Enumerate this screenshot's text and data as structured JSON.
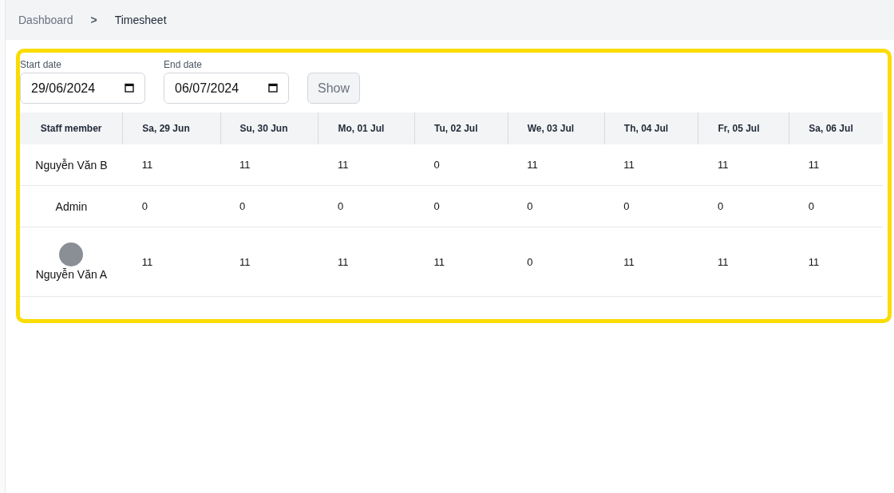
{
  "breadcrumb": [
    {
      "label": "Dashboard",
      "current": false
    },
    {
      "label": "Timesheet",
      "current": true
    }
  ],
  "breadcrumb_separator": ">",
  "filters": [
    {
      "label": "Start date",
      "value": "29/06/2024"
    },
    {
      "label": "End date",
      "value": "06/07/2024"
    }
  ],
  "show_button": "Show",
  "table": {
    "columns": [
      "Staff member",
      "Sa, 29 Jun",
      "Su, 30 Jun",
      "Mo, 01 Jul",
      "Tu, 02 Jul",
      "We, 03 Jul",
      "Th, 04 Jul",
      "Fr, 05 Jul",
      "Sa, 06 Jul"
    ],
    "rows": [
      {
        "name": "Nguyễn Văn B",
        "avatar": false,
        "hours": [
          "11",
          "11",
          "11",
          "0",
          "11",
          "11",
          "11",
          "11"
        ]
      },
      {
        "name": "Admin",
        "avatar": false,
        "hours": [
          "0",
          "0",
          "0",
          "0",
          "0",
          "0",
          "0",
          "0"
        ]
      },
      {
        "name": "Nguyễn Văn A",
        "avatar": true,
        "hours": [
          "11",
          "11",
          "11",
          "11",
          "0",
          "11",
          "11",
          "11"
        ]
      }
    ]
  }
}
